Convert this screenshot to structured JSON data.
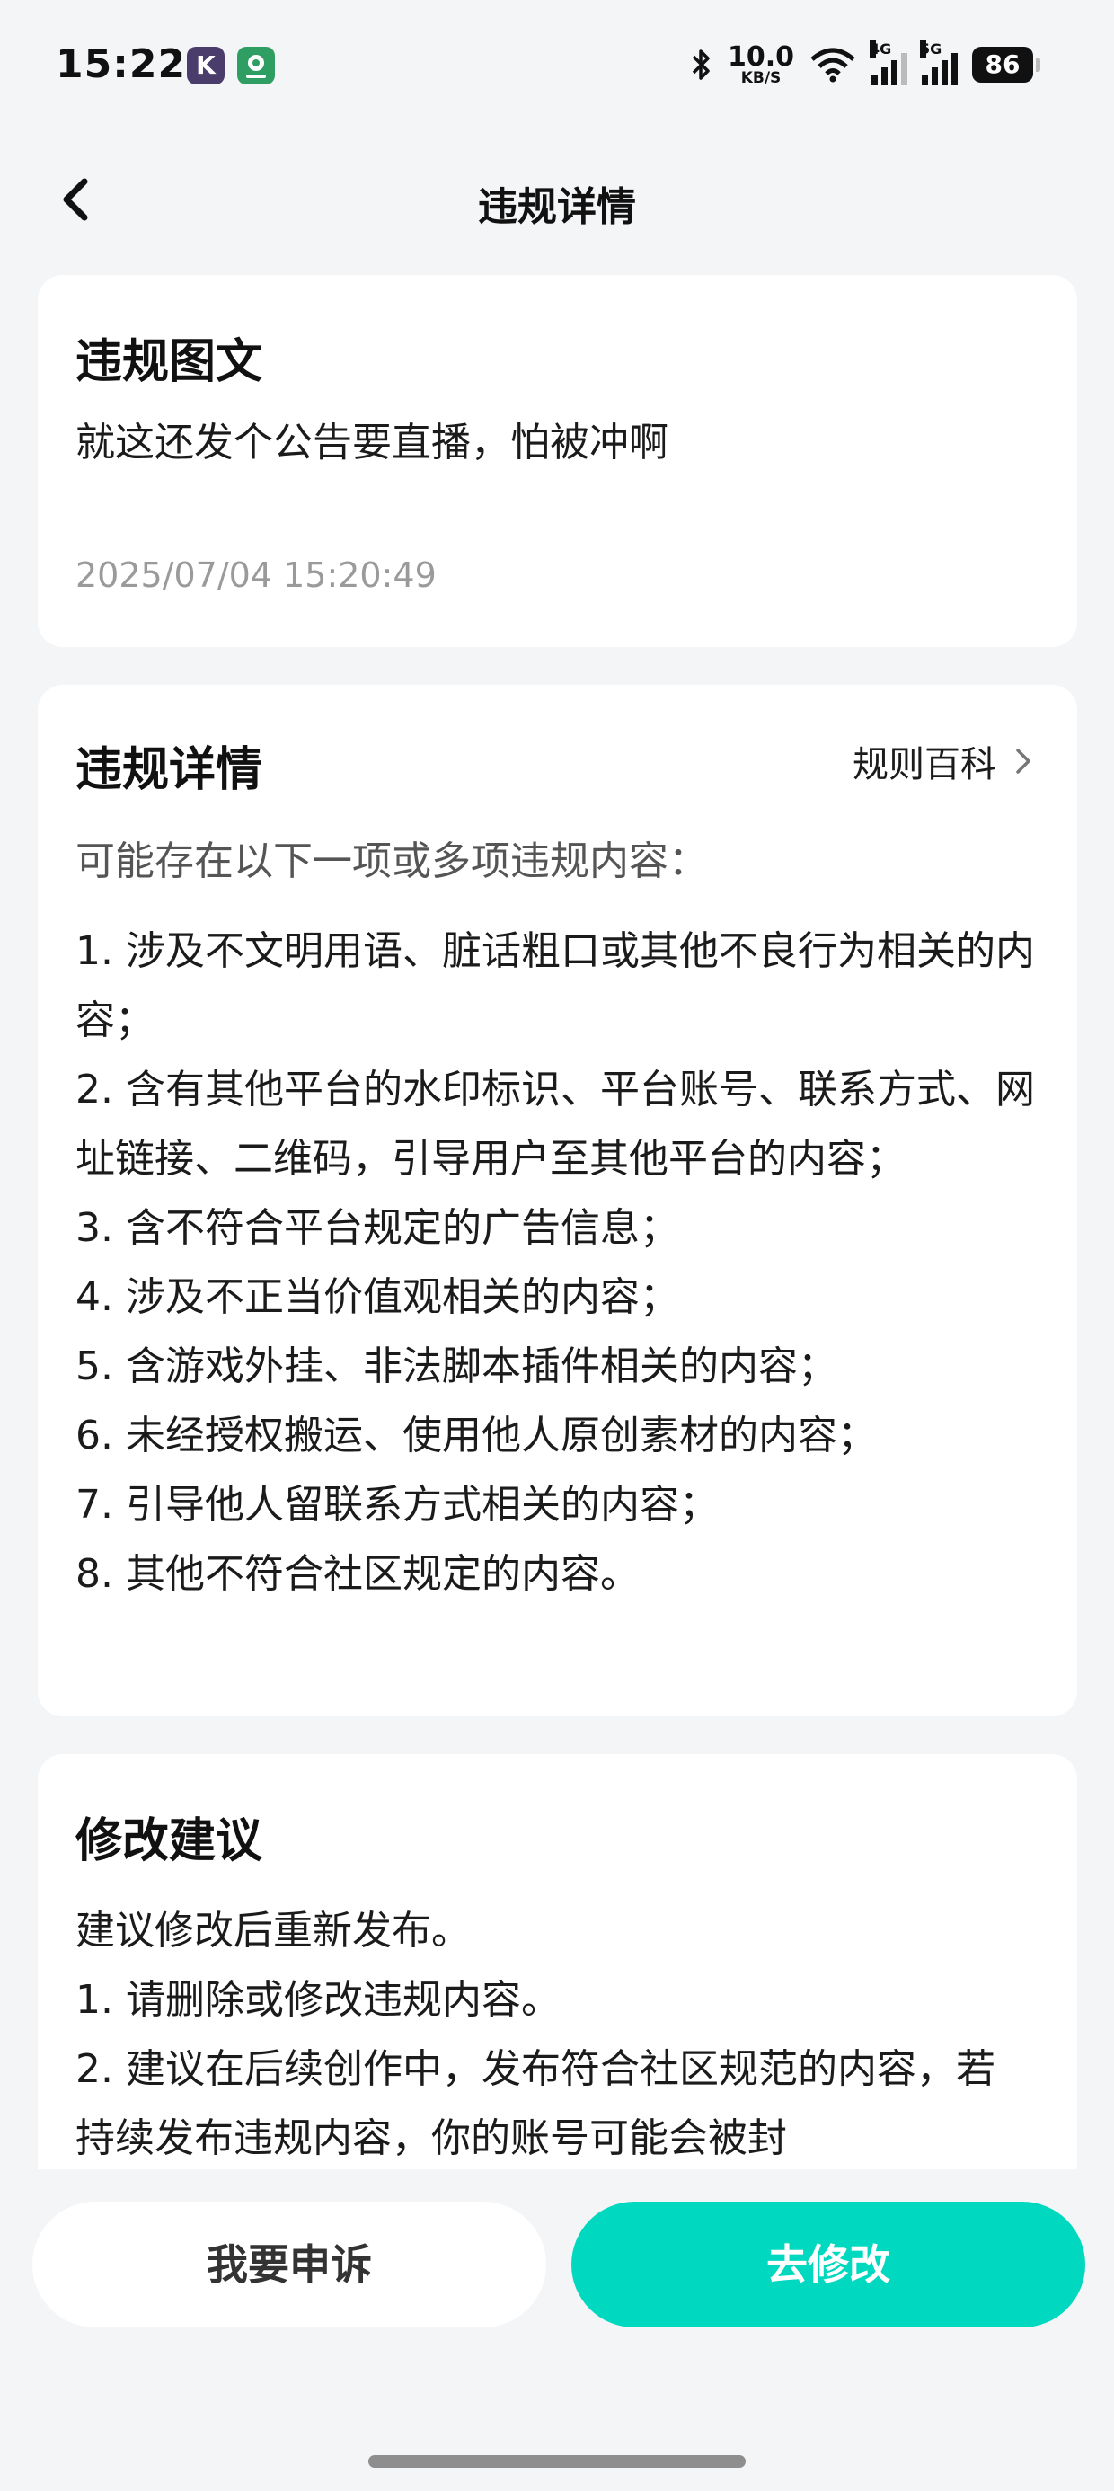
{
  "status_bar": {
    "time": "15:22",
    "app_icon_1": "K",
    "network_speed": "10.0",
    "network_unit": "KB/S",
    "signal_1_tag": "4G",
    "signal_2_tag": "5G",
    "battery": "86"
  },
  "header": {
    "title": "违规详情"
  },
  "content_card": {
    "heading": "违规图文",
    "text": "就这还发个公告要直播，怕被冲啊",
    "timestamp": "2025/07/04 15:20:49"
  },
  "violation_card": {
    "heading": "违规详情",
    "rules_link": "规则百科",
    "intro": "可能存在以下一项或多项违规内容：",
    "items": [
      "1. 涉及不文明用语、脏话粗口或其他不良行为相关的内容；",
      "2. 含有其他平台的水印标识、平台账号、联系方式、网址链接、二维码，引导用户至其他平台的内容；",
      "3. 含不符合平台规定的广告信息；",
      "4. 涉及不正当价值观相关的内容；",
      "5. 含游戏外挂、非法脚本插件相关的内容；",
      "6. 未经授权搬运、使用他人原创素材的内容；",
      "7. 引导他人留联系方式相关的内容；",
      "8. 其他不符合社区规定的内容。"
    ]
  },
  "suggestion_card": {
    "heading": "修改建议",
    "lines": [
      "建议修改后重新发布。",
      "1. 请删除或修改违规内容。",
      "2. 建议在后续创作中，发布符合社区规范的内容，若持续发布违规内容，你的账号可能会被封"
    ]
  },
  "actions": {
    "appeal_label": "我要申诉",
    "edit_label": "去修改"
  },
  "colors": {
    "primary": "#00d8c0",
    "background": "#f4f5f7"
  }
}
